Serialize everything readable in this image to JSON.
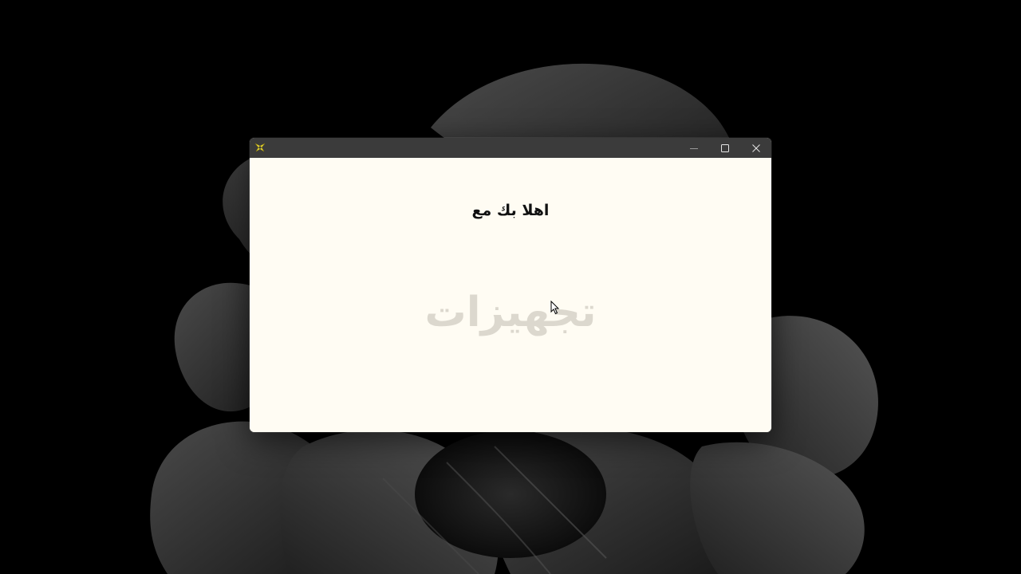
{
  "desktop": {
    "background": "#000000",
    "wallpaper_color": "#3a3a3a"
  },
  "window": {
    "title_bar_color": "#3b3b3b",
    "content_background": "#fffcf3",
    "app_icon": "app-icon",
    "controls": {
      "minimize_icon": "minimize-icon",
      "maximize_icon": "maximize-icon",
      "close_icon": "close-icon"
    }
  },
  "content": {
    "welcome_text": "اهلا بك مع",
    "brand_text": "تجهيزات",
    "brand_color": "#dcd8ce"
  }
}
